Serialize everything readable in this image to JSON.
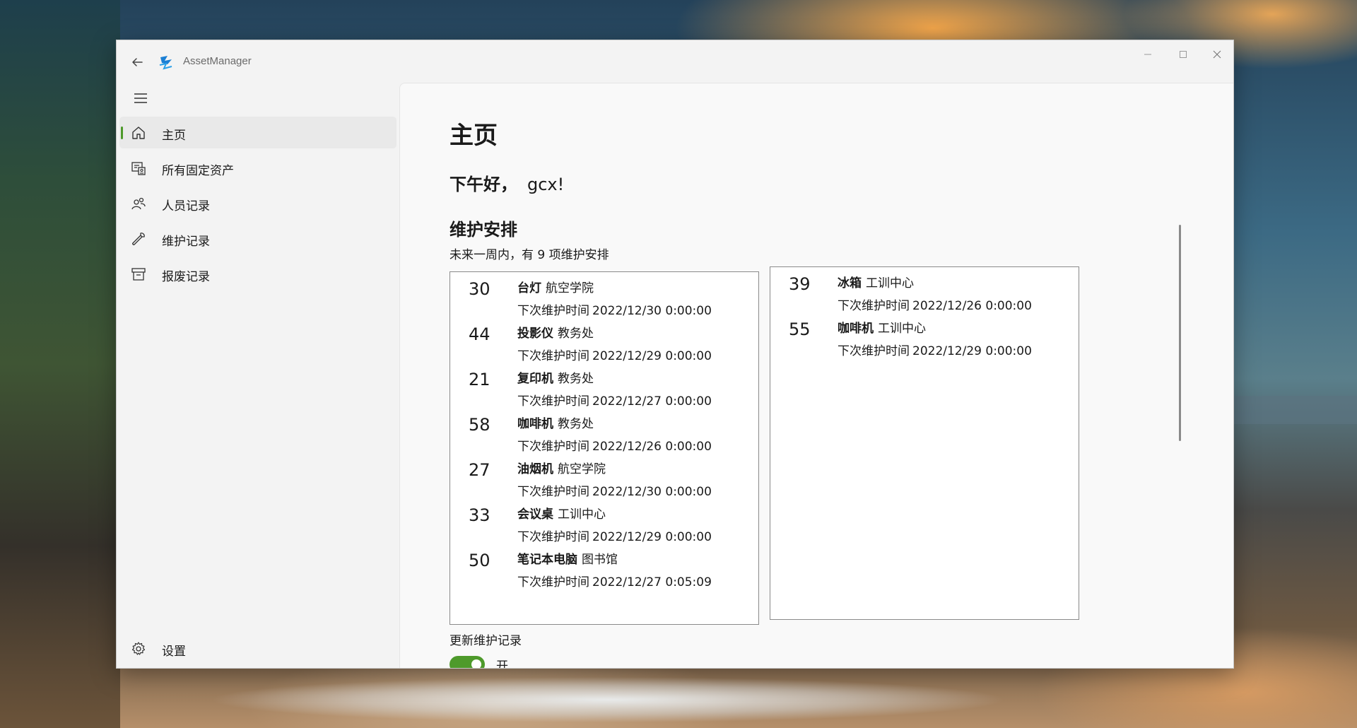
{
  "window": {
    "app_title": "AssetManager"
  },
  "nav": {
    "items": [
      {
        "label": "主页",
        "icon": "home-icon",
        "active": true
      },
      {
        "label": "所有固定资产",
        "icon": "asset-register-icon",
        "active": false
      },
      {
        "label": "人员记录",
        "icon": "people-icon",
        "active": false
      },
      {
        "label": "维护记录",
        "icon": "wrench-icon",
        "active": false
      },
      {
        "label": "报废记录",
        "icon": "archive-icon",
        "active": false
      }
    ],
    "settings_label": "设置"
  },
  "home": {
    "title": "主页",
    "greeting": "下午好，",
    "user": "gcx!",
    "section_title": "维护安排",
    "summary": "未来一周内，有 9 项维护安排",
    "next_label": "下次维护时间",
    "left_items": [
      {
        "id": "30",
        "name": "台灯",
        "dept": "航空学院",
        "date": "2022/12/30 0:00:00"
      },
      {
        "id": "44",
        "name": "投影仪",
        "dept": "教务处",
        "date": "2022/12/29 0:00:00"
      },
      {
        "id": "21",
        "name": "复印机",
        "dept": "教务处",
        "date": "2022/12/27 0:00:00"
      },
      {
        "id": "58",
        "name": "咖啡机",
        "dept": "教务处",
        "date": "2022/12/26 0:00:00"
      },
      {
        "id": "27",
        "name": "油烟机",
        "dept": "航空学院",
        "date": "2022/12/30 0:00:00"
      },
      {
        "id": "33",
        "name": "会议桌",
        "dept": "工训中心",
        "date": "2022/12/29 0:00:00"
      },
      {
        "id": "50",
        "name": "笔记本电脑",
        "dept": "图书馆",
        "date": "2022/12/27 0:05:09"
      }
    ],
    "right_items": [
      {
        "id": "39",
        "name": "冰箱",
        "dept": "工训中心",
        "date": "2022/12/26 0:00:00"
      },
      {
        "id": "55",
        "name": "咖啡机",
        "dept": "工训中心",
        "date": "2022/12/29 0:00:00"
      }
    ],
    "update_label": "更新维护记录",
    "toggle_state": "开"
  },
  "colors": {
    "accent": "#4e9a2b",
    "logo_blue": "#1a7fd4"
  }
}
